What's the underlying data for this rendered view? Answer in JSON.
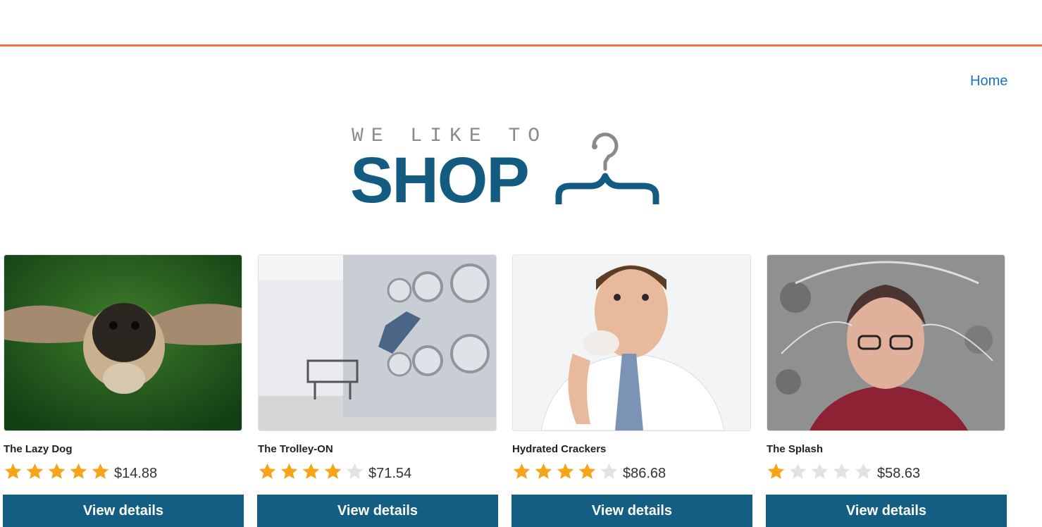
{
  "header": {
    "accent_color": "#f0733a"
  },
  "nav": {
    "home_label": "Home",
    "link_color": "#1a73c2"
  },
  "logo": {
    "tagline": "WE LIKE TO",
    "wordmark": "SHOP",
    "icon": "clothes-hanger-icon",
    "brand_color": "#135b80"
  },
  "products": [
    {
      "title": "The Lazy Dog",
      "rating": 5,
      "max_rating": 5,
      "price": "$14.88",
      "button_label": "View details",
      "image_subject": "flying-pug-image"
    },
    {
      "title": "The Trolley-ON",
      "rating": 4,
      "max_rating": 5,
      "price": "$71.54",
      "button_label": "View details",
      "image_subject": "laundromat-image"
    },
    {
      "title": "Hydrated Crackers",
      "rating": 4,
      "max_rating": 5,
      "price": "$86.68",
      "button_label": "View details",
      "image_subject": "man-eating-cracker-image"
    },
    {
      "title": "The Splash",
      "rating": 1,
      "max_rating": 5,
      "price": "$58.63",
      "button_label": "View details",
      "image_subject": "water-splash-image"
    }
  ],
  "colors": {
    "star_filled": "#f6a51b",
    "star_empty": "#dfe3e6",
    "button_bg": "#135e82"
  }
}
